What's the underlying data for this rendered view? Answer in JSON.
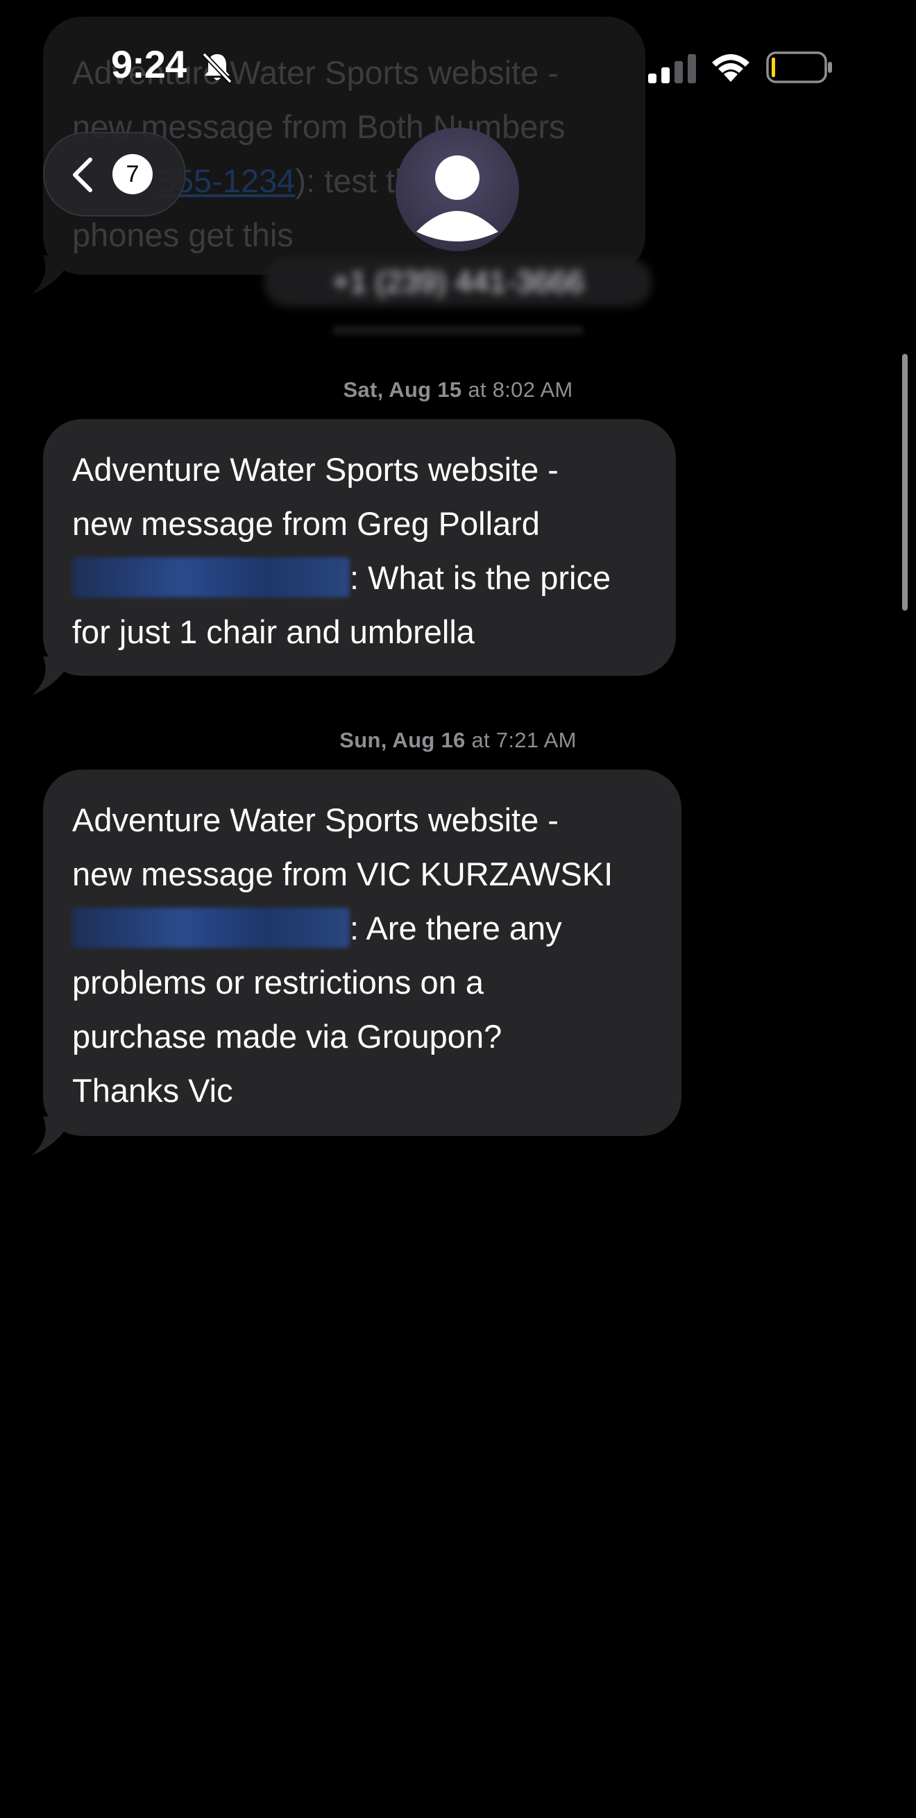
{
  "status_bar": {
    "time": "9:24"
  },
  "header": {
    "back_count": "7",
    "contact_name": "+1 (239) 441-3666"
  },
  "faded_message": {
    "lines": [
      "Adventure Water Sports website -",
      "new message from Both Numbers",
      "555-1234",
      "): test that both",
      "phones get this"
    ]
  },
  "messages": [
    {
      "timestamp_day": "Sat, Aug 15",
      "timestamp_time": "at 8:02 AM",
      "line1": "Adventure Water Sports website -",
      "line2": "new message from Greg Pollard",
      "after_redacted": ": What is the price",
      "line4": "for just 1 chair and umbrella"
    },
    {
      "timestamp_day": "Sun, Aug 16",
      "timestamp_time": "at 7:21 AM",
      "line1": "Adventure Water Sports website -",
      "line2": "new message from VIC KURZAWSKI",
      "after_redacted": ": Are there any",
      "line4": "problems or restrictions on a",
      "line5": "purchase made via Groupon?",
      "line6": "Thanks Vic"
    }
  ],
  "colors": {
    "background": "#000000",
    "bubble": "#262628",
    "timestamp": "#8e8e93",
    "redacted_link": "#2b4a8d"
  }
}
